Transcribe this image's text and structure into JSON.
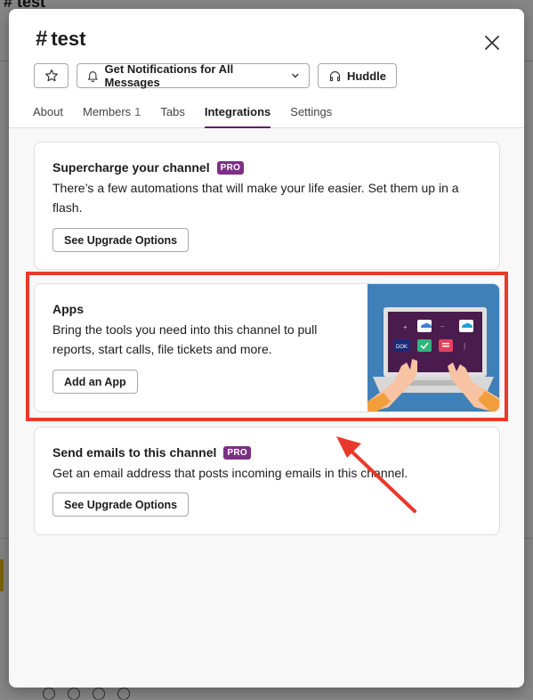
{
  "background": {
    "channel_title": "# test"
  },
  "modal": {
    "hash": "#",
    "channel_name": "test",
    "toolbar": {
      "notifications_label": "Get Notifications for All Messages",
      "huddle_label": "Huddle"
    },
    "tabs": [
      {
        "label": "About"
      },
      {
        "label": "Members",
        "count": "1"
      },
      {
        "label": "Tabs"
      },
      {
        "label": "Integrations",
        "active": true
      },
      {
        "label": "Settings"
      }
    ],
    "cards": {
      "supercharge": {
        "title": "Supercharge your channel",
        "badge": "PRO",
        "description": "There’s a few automations that will make your life easier. Set them up in a flash.",
        "button": "See Upgrade Options"
      },
      "apps": {
        "title": "Apps",
        "description": "Bring the tools you need into this channel to pull reports, start calls, file tickets and more.",
        "button": "Add an App"
      },
      "emails": {
        "title": "Send emails to this channel",
        "badge": "PRO",
        "description": "Get an email address that posts incoming emails in this channel.",
        "button": "See Upgrade Options"
      }
    }
  },
  "colors": {
    "accent": "#611f69",
    "pro_badge": "#7c3085",
    "annotation": "#e8392b"
  },
  "icons": [
    "star-icon",
    "bell-icon",
    "chevron-down-icon",
    "headphones-icon",
    "close-icon"
  ]
}
